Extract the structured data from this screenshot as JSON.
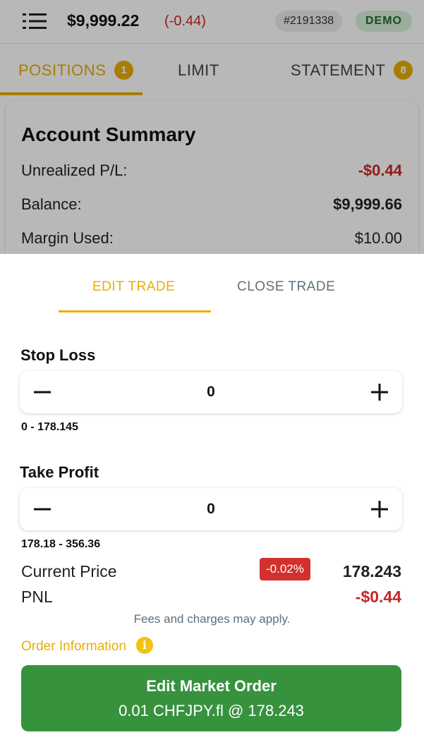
{
  "header": {
    "balance": "$9,999.22",
    "change": "(-0.44)",
    "account_id": "#2191338",
    "mode_badge": "DEMO"
  },
  "tabs": [
    {
      "label": "POSITIONS",
      "count": "1",
      "active": true
    },
    {
      "label": "LIMIT",
      "count": "",
      "active": false
    },
    {
      "label": "STATEMENT",
      "count": "8",
      "active": false
    }
  ],
  "summary": {
    "title": "Account Summary",
    "rows": [
      {
        "label": "Unrealized P/L:",
        "value": "-$0.44"
      },
      {
        "label": "Balance:",
        "value": "$9,999.66"
      },
      {
        "label": "Margin Used:",
        "value": "$10.00"
      }
    ]
  },
  "sheet": {
    "tabs": [
      "EDIT TRADE",
      "CLOSE TRADE"
    ],
    "active_tab": "EDIT TRADE",
    "stop_loss": {
      "label": "Stop Loss",
      "value": "0",
      "range": "0 - 178.145",
      "minus": "−",
      "plus": "+"
    },
    "take_profit": {
      "label": "Take Profit",
      "value": "0",
      "range": "178.18 - 356.36",
      "minus": "−",
      "plus": "+"
    },
    "current_price": {
      "label": "Current Price",
      "change_pct": "-0.02%",
      "value": "178.243"
    },
    "pnl": {
      "label": "PNL",
      "value": "-$0.44"
    },
    "fees_note": "Fees and charges may apply.",
    "order_info_label": "Order Information",
    "submit": {
      "title": "Edit Market Order",
      "subtitle": "0.01 CHFJPY.fl @ 178.243"
    }
  },
  "colors": {
    "accent": "#e8ae00",
    "negative": "#c62828",
    "submit_green": "#37923e",
    "demo_badge_bg": "#d8f0dc"
  },
  "icons": [
    "menu-icon",
    "info-icon",
    "minus-icon",
    "plus-icon"
  ]
}
